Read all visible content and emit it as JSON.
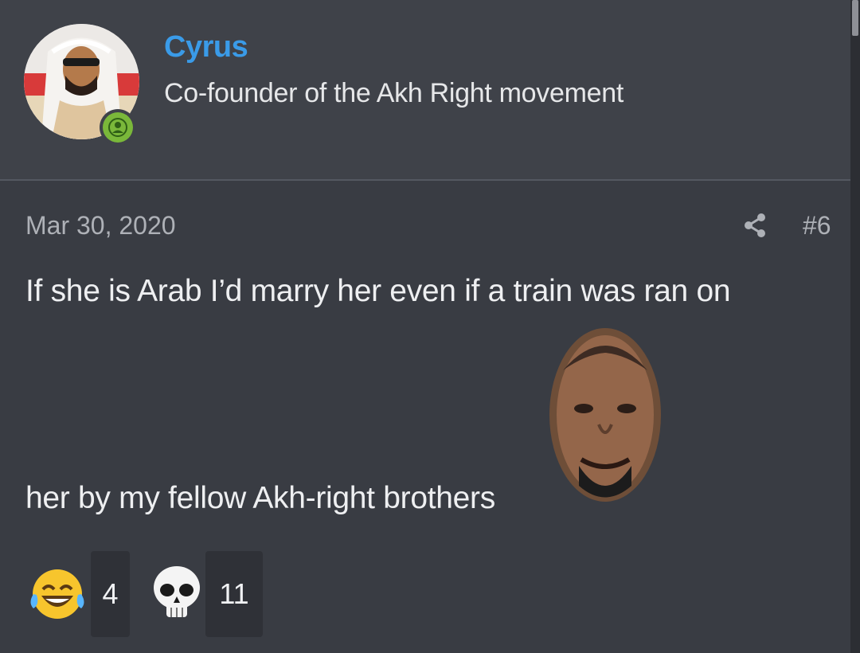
{
  "user": {
    "name": "Cyrus",
    "title": "Co-founder of the Akh Right movement",
    "online": true,
    "avatar_icon": "user-avatar",
    "online_icon": "person-online-icon"
  },
  "post": {
    "date": "Mar 30, 2020",
    "number": "#6",
    "share_icon": "share-icon",
    "text_line_1": "If she is Arab I’d marry her even if a train was ran on",
    "text_line_2": "her by my fellow Akh-right brothers",
    "inline_image_icon": "smiling-face-sticker"
  },
  "reactions": [
    {
      "icon": "tears-of-joy-emoji",
      "count": "4"
    },
    {
      "icon": "skull-emoji",
      "count": "11"
    }
  ],
  "colors": {
    "username": "#3a9be8",
    "online": "#7ab83a",
    "background": "#393c43",
    "header_background": "#3f4249"
  }
}
